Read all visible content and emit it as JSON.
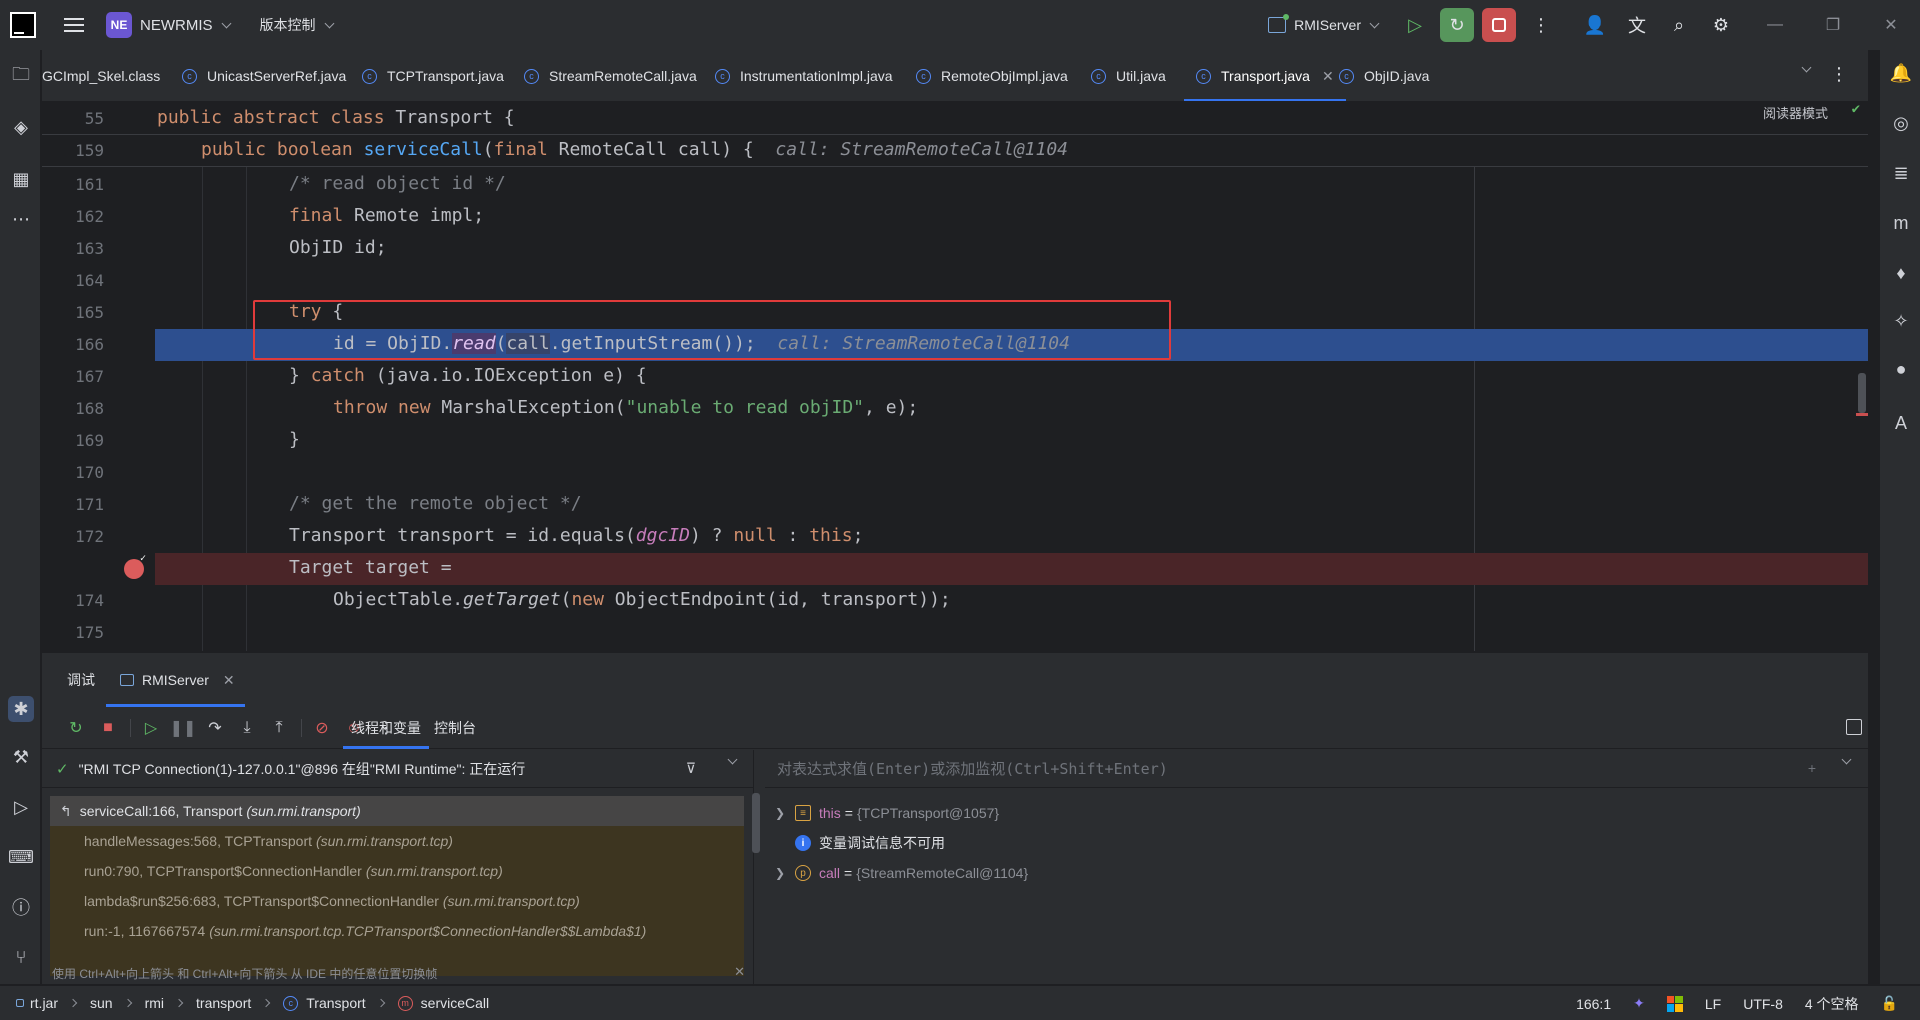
{
  "titlebar": {
    "project_badge": "NE",
    "project_name": "NEWRMIS",
    "vcs_label": "版本控制",
    "run_config": "RMIServer"
  },
  "tabs": [
    {
      "label": "GCImpl_Skel.class"
    },
    {
      "label": "UnicastServerRef.java"
    },
    {
      "label": "TCPTransport.java"
    },
    {
      "label": "StreamRemoteCall.java"
    },
    {
      "label": "InstrumentationImpl.java"
    },
    {
      "label": "RemoteObjImpl.java"
    },
    {
      "label": "Util.java"
    },
    {
      "label": "Transport.java",
      "active": true
    },
    {
      "label": "ObjID.java"
    }
  ],
  "editor": {
    "reader_mode": "阅读器模式",
    "sticky_lines": [
      {
        "num": "55",
        "text": "public abstract class Transport {"
      },
      {
        "num": "159",
        "text": "public boolean serviceCall(final RemoteCall call) {",
        "inlay": "call: StreamRemoteCall@1104"
      }
    ],
    "lines": [
      {
        "num": "161",
        "text": "/* read object id */"
      },
      {
        "num": "162",
        "text": "final Remote impl;"
      },
      {
        "num": "163",
        "text": "ObjID id;"
      },
      {
        "num": "164",
        "text": ""
      },
      {
        "num": "165",
        "text": "try {"
      },
      {
        "num": "166",
        "text": "id = ObjID.read(call.getInputStream());",
        "inlay": "call: StreamRemoteCall@1104"
      },
      {
        "num": "167",
        "text": "} catch (java.io.IOException e) {"
      },
      {
        "num": "168",
        "text": "throw new MarshalException(\"unable to read objID\", e);"
      },
      {
        "num": "169",
        "text": "}"
      },
      {
        "num": "170",
        "text": ""
      },
      {
        "num": "171",
        "text": "/* get the remote object */"
      },
      {
        "num": "172",
        "text": "Transport transport = id.equals(dgcID) ? null : this;"
      },
      {
        "num": "",
        "text": "Target target ="
      },
      {
        "num": "174",
        "text": "ObjectTable.getTarget(new ObjectEndpoint(id, transport));"
      },
      {
        "num": "175",
        "text": ""
      }
    ]
  },
  "debug": {
    "title": "调试",
    "session_tab": "RMIServer",
    "subtabs": [
      "线程和变量",
      "控制台"
    ],
    "thread": "\"RMI TCP Connection(1)-127.0.0.1\"@896 在组\"RMI Runtime\": 正在运行",
    "frames": [
      {
        "method": "serviceCall:166, Transport",
        "pkg": "(sun.rmi.transport)"
      },
      {
        "method": "handleMessages:568, TCPTransport",
        "pkg": "(sun.rmi.transport.tcp)"
      },
      {
        "method": "run0:790, TCPTransport$ConnectionHandler",
        "pkg": "(sun.rmi.transport.tcp)"
      },
      {
        "method": "lambda$run$256:683, TCPTransport$ConnectionHandler",
        "pkg": "(sun.rmi.transport.tcp)"
      },
      {
        "method": "run:-1, 1167667574",
        "pkg": "(sun.rmi.transport.tcp.TCPTransport$ConnectionHandler$$Lambda$1)"
      }
    ],
    "frames_hint": "使用 Ctrl+Alt+向上箭头 和 Ctrl+Alt+向下箭头 从 IDE 中的任意位置切换帧",
    "eval_placeholder": "对表达式求值(Enter)或添加监视(Ctrl+Shift+Enter)",
    "vars": [
      {
        "name": "this",
        "value": "{TCPTransport@1057}",
        "icon": "field-icon"
      },
      {
        "name": "",
        "value": "变量调试信息不可用",
        "icon": "info-icon"
      },
      {
        "name": "call",
        "value": "{StreamRemoteCall@1104}",
        "icon": "parameter-icon"
      }
    ]
  },
  "statusbar": {
    "breadcrumb": [
      "rt.jar",
      "sun",
      "rmi",
      "transport",
      "Transport",
      "serviceCall"
    ],
    "position": "166:1",
    "line_sep": "LF",
    "encoding": "UTF-8",
    "indent": "4 个空格"
  }
}
